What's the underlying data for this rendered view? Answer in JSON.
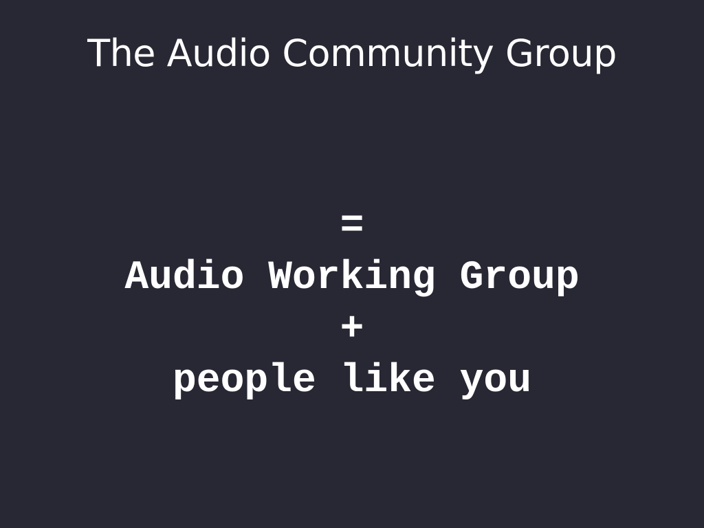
{
  "slide": {
    "title": "The Audio Community Group",
    "lines": [
      "=",
      "Audio Working Group",
      "+",
      "people like you"
    ]
  },
  "colors": {
    "background": "#282834",
    "text": "#ffffff"
  }
}
